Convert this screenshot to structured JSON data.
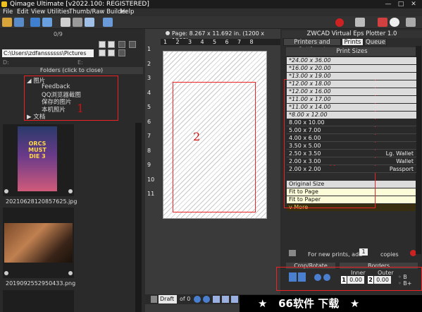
{
  "title": "Qimage Ultimate [v2022.100: REGISTERED]",
  "window_buttons": [
    "—",
    "□",
    "✕"
  ],
  "menu": [
    "File",
    "Edit",
    "View",
    "Utilities",
    "Thumb/Raw Builder",
    "Help"
  ],
  "left": {
    "counter": "0/9",
    "path": "C:\\Users\\zdfanssssss\\Pictures",
    "drive_d": "D:",
    "drive_e": "E:",
    "folders_header": "Folders (click to close)",
    "tree": [
      "图片",
      "Feedback",
      "QQ浏览器截图",
      "保存的图片",
      "本机照片",
      "文档"
    ],
    "thumbs": [
      {
        "caption": "20210628120857625.jpg",
        "poster_line1": "ORCS",
        "poster_line2": "MUST",
        "poster_line3": "DIE 3"
      },
      {
        "caption": "2019092552950433.png"
      }
    ],
    "annotation_1": "1"
  },
  "middle": {
    "page_info": "Page: 8.267 x 11.692 in. (1200 x 1200)",
    "ruler_x": [
      "1",
      "2",
      "3",
      "4",
      "5",
      "6",
      "7",
      "8"
    ],
    "ruler_y": [
      "1",
      "2",
      "3",
      "4",
      "5",
      "6",
      "7",
      "8",
      "9",
      "10",
      "11"
    ],
    "annotation_2": "2",
    "mode": "Draft",
    "of": "of 0"
  },
  "right": {
    "plotter": "ZWCAD Virtual Eps Plotter 1.0",
    "tabs": [
      "Printers and Settings*",
      "Prints",
      "Queue"
    ],
    "print_sizes_header": "Print Sizes",
    "sizes_light": [
      "*24.00 x 36.00",
      "*16.00 x 20.00",
      "*13.00 x 19.00",
      "*12.00 x 18.00",
      "*12.00 x 16.00",
      "*11.00 x 17.00",
      "*11.00 x 14.00",
      "*8.00 x 12.00"
    ],
    "sizes_dark": [
      {
        "size": "8.00 x 10.00",
        "label": ""
      },
      {
        "size": "5.00 x 7.00",
        "label": ""
      },
      {
        "size": "4.00 x 6.00",
        "label": ""
      },
      {
        "size": "3.50 x 5.00",
        "label": ""
      },
      {
        "size": "2.50 x 3.50",
        "label": "Lg. Wallet"
      },
      {
        "size": "2.00 x 3.00",
        "label": "Wallet"
      },
      {
        "size": "2.00 x 2.00",
        "label": "Passport"
      }
    ],
    "original_size": "Original Size",
    "fit_page": "Fit to Page",
    "fit_paper": "Fit to Paper",
    "more": "v More",
    "new_prints_label": "For new prints, add",
    "copies_value": "1",
    "copies_label": "copies",
    "annotation_3": "3",
    "crop_rotate": "Crop/Rotate",
    "borders": "Borders",
    "inner": "Inner",
    "outer": "Outer",
    "inner_value": "0.00",
    "outer_value": "0.00",
    "inner_num": "1",
    "outer_num": "2",
    "b_label": "B",
    "bplus_label": "B+"
  },
  "banner": "★   66软件 下载   ★",
  "colors": {
    "annotation_red": "#e02020",
    "accent": "#e8c060"
  }
}
